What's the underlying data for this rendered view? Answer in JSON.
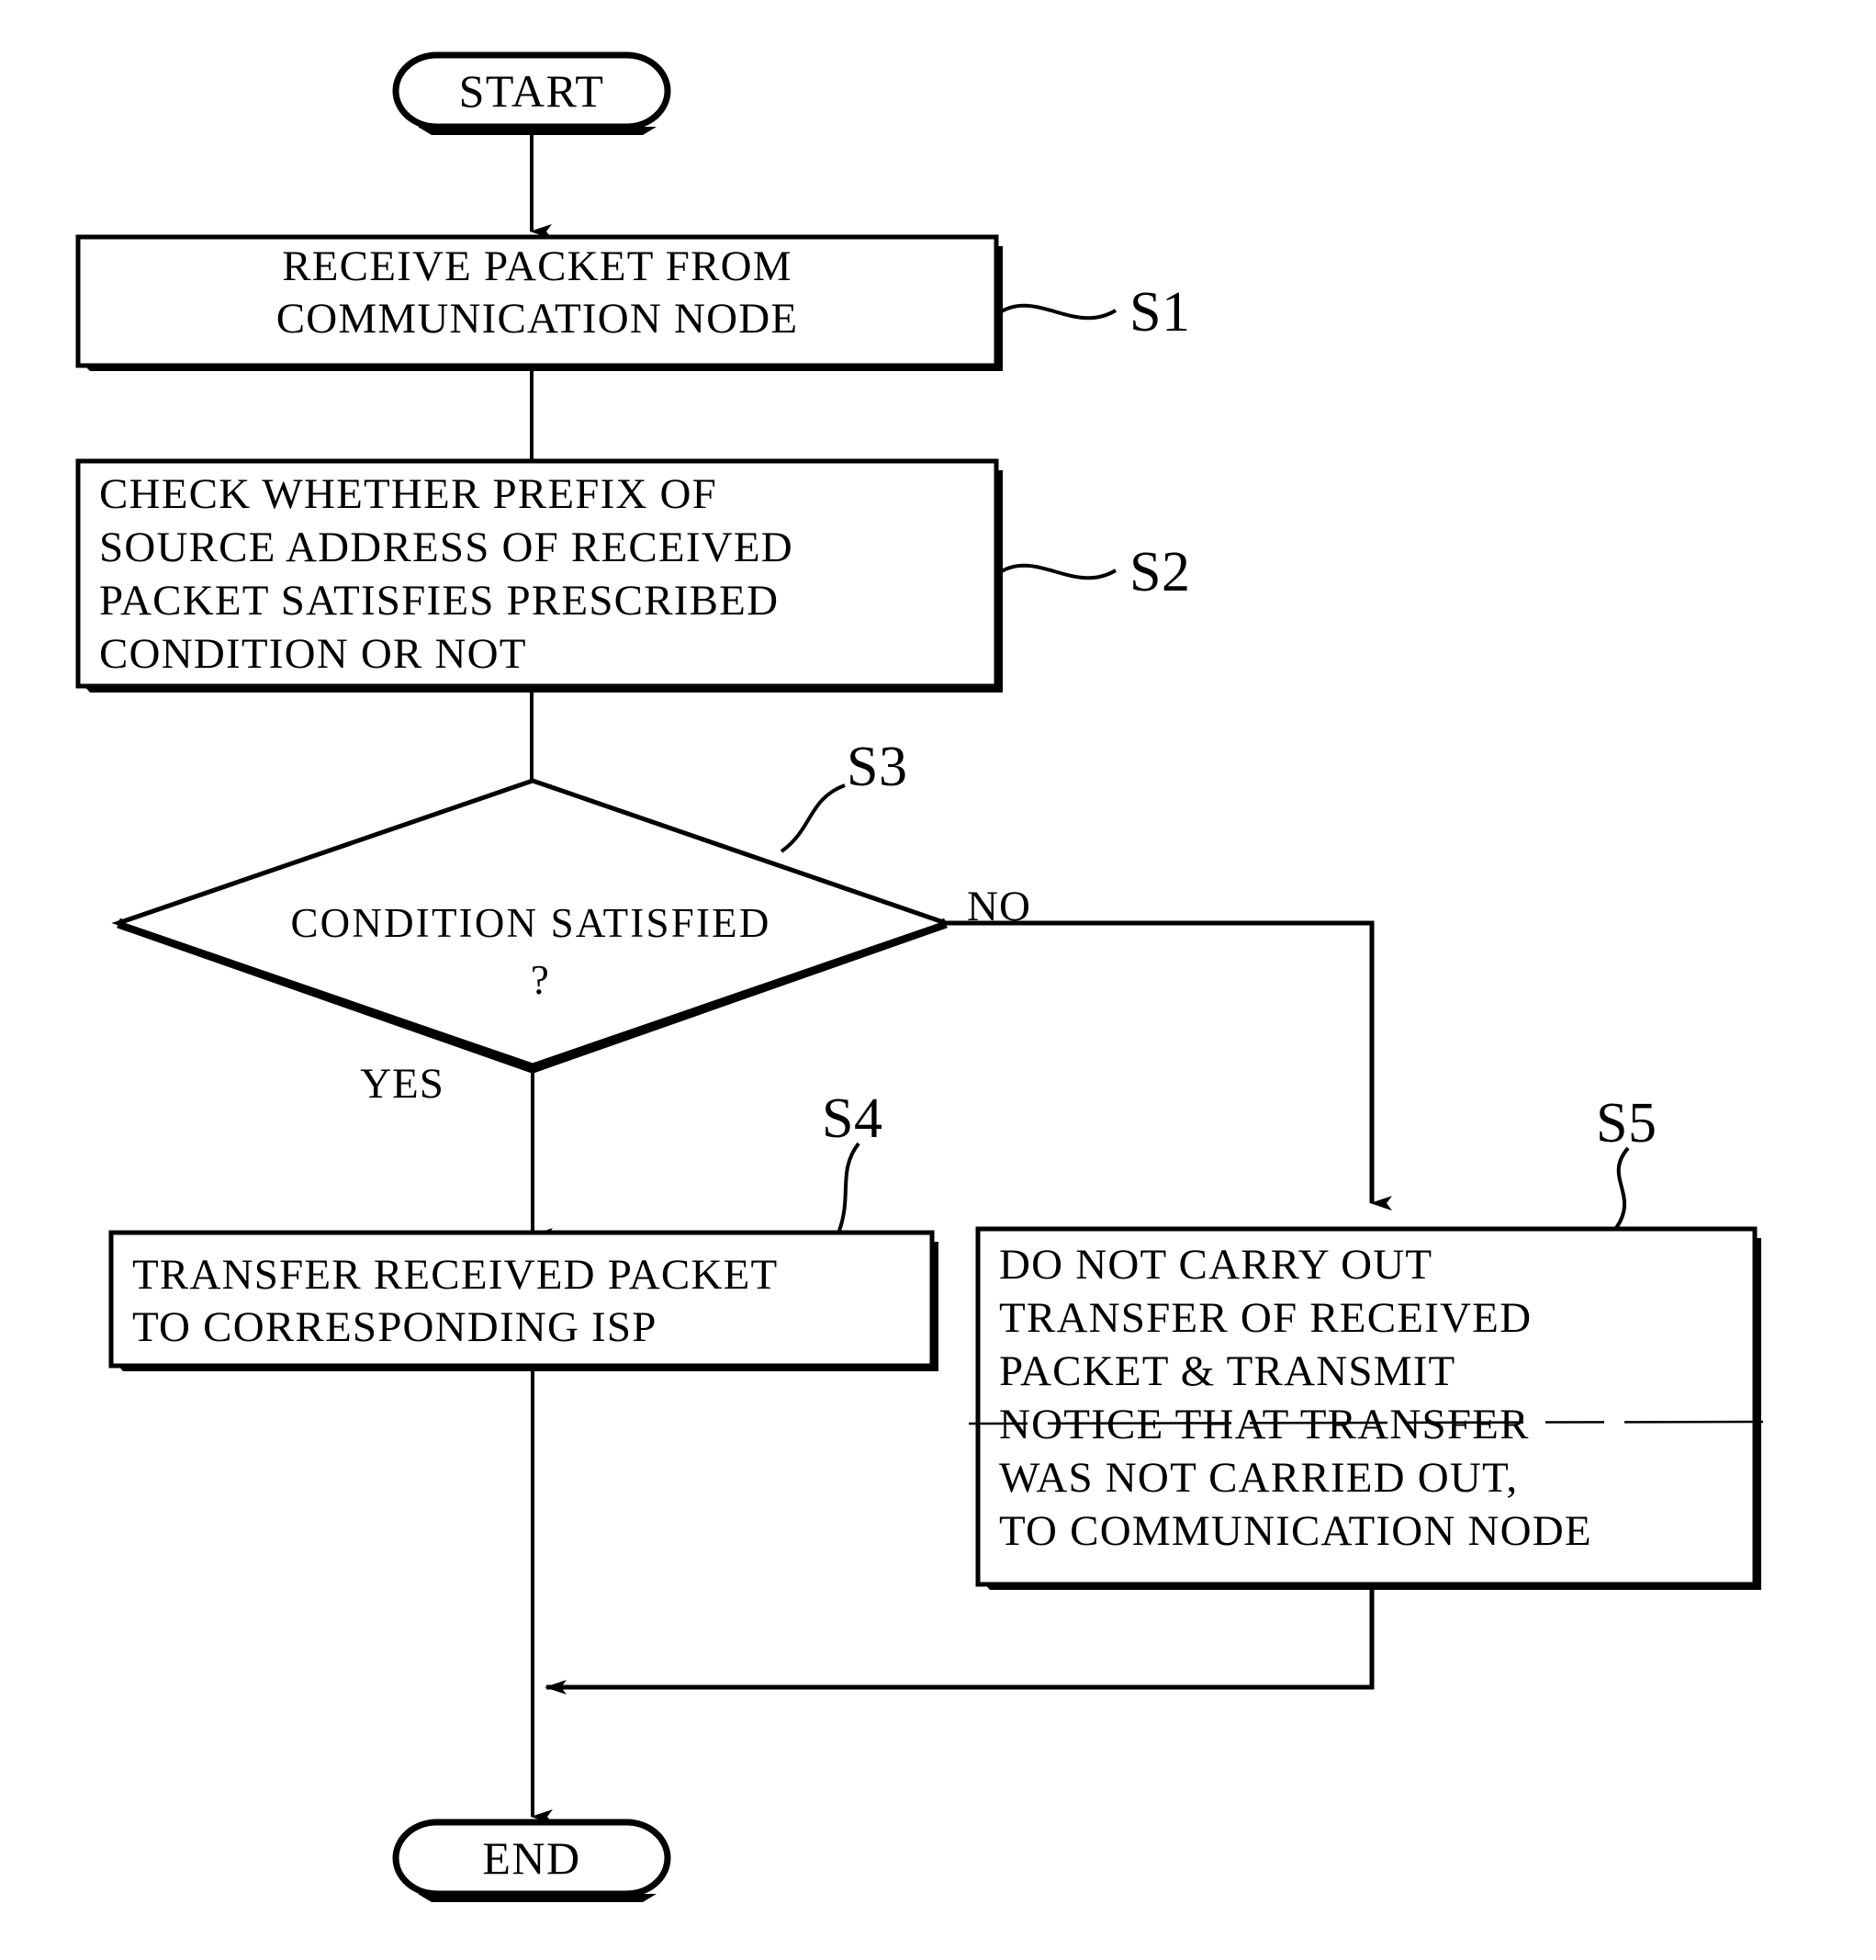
{
  "figure": {
    "type": "flowchart",
    "title": "",
    "orientation": "top-to-bottom"
  },
  "nodes": {
    "start": {
      "shape": "terminal",
      "label": "START"
    },
    "s1": {
      "shape": "process",
      "step_label": "S1",
      "lines": [
        "RECEIVE PACKET FROM",
        "COMMUNICATION NODE"
      ]
    },
    "s2": {
      "shape": "process",
      "step_label": "S2",
      "lines": [
        "CHECK WHETHER PREFIX OF",
        "SOURCE ADDRESS OF RECEIVED",
        "PACKET SATISFIES PRESCRIBED",
        "CONDITION OR NOT"
      ]
    },
    "s3": {
      "shape": "decision",
      "step_label": "S3",
      "lines": [
        "CONDITION SATISFIED",
        "?"
      ]
    },
    "s4": {
      "shape": "process",
      "step_label": "S4",
      "lines": [
        "TRANSFER RECEIVED PACKET",
        "TO CORRESPONDING ISP"
      ]
    },
    "s5": {
      "shape": "process",
      "step_label": "S5",
      "lines": [
        "DO NOT CARRY OUT",
        "TRANSFER OF RECEIVED",
        "PACKET & TRANSMIT",
        "NOTICE THAT TRANSFER",
        "WAS NOT CARRIED OUT,",
        "TO COMMUNICATION NODE"
      ]
    },
    "end": {
      "shape": "terminal",
      "label": "END"
    }
  },
  "branches": {
    "yes_label": "YES",
    "no_label": "NO"
  },
  "colors": {
    "stroke": "#000000",
    "fill": "#ffffff",
    "background": "#ffffff"
  }
}
